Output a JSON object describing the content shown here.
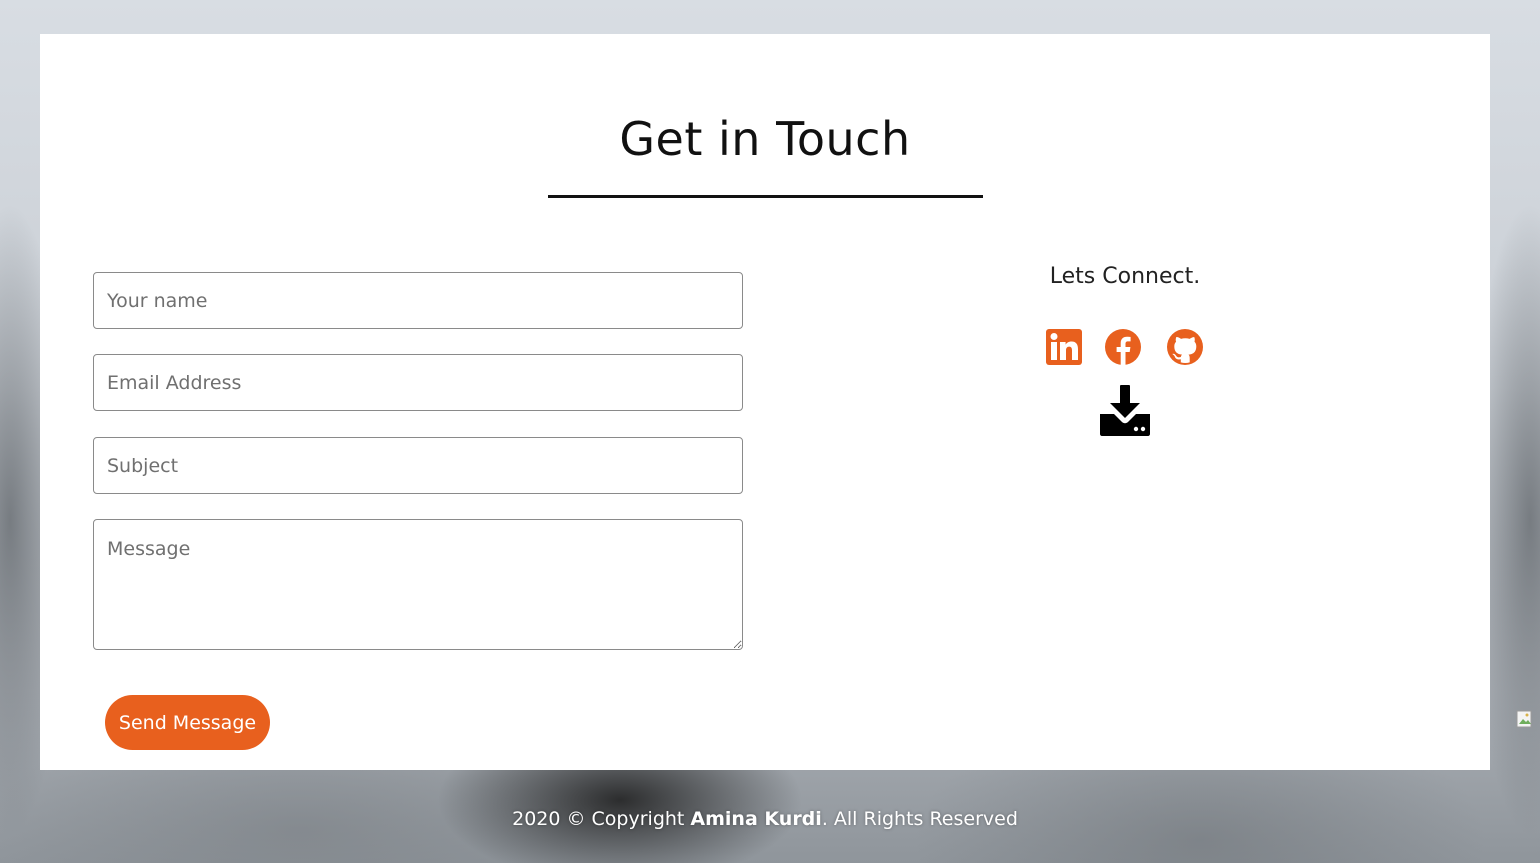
{
  "page": {
    "title": "Get in Touch"
  },
  "form": {
    "name_placeholder": "Your name",
    "email_placeholder": "Email Address",
    "subject_placeholder": "Subject",
    "message_placeholder": "Message",
    "name_value": "",
    "email_value": "",
    "subject_value": "",
    "message_value": "",
    "submit_label": "Send Message"
  },
  "connect": {
    "heading": "Lets Connect.",
    "icons": [
      "linkedin-icon",
      "facebook-icon",
      "github-icon",
      "download-icon"
    ]
  },
  "footer": {
    "prefix": "2020 © Copyright ",
    "owner": "Amina Kurdi",
    "suffix": ". All Rights Reserved"
  },
  "colors": {
    "accent": "#e8601e",
    "text": "#111111",
    "card": "#ffffff"
  }
}
